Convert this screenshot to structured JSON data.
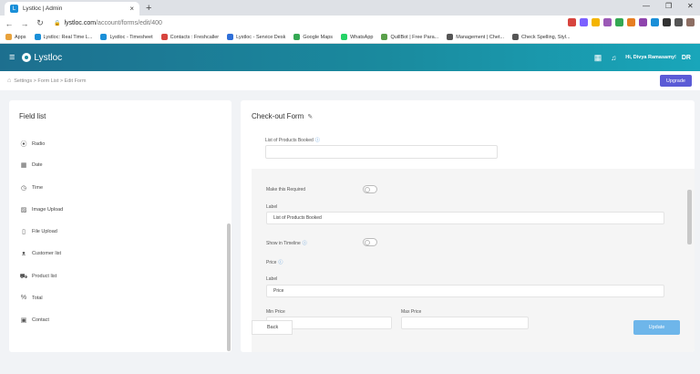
{
  "browser": {
    "tab_title": "Lystloc | Admin",
    "url_host": "lystloc.com",
    "url_path": "/account/forms/edit/400",
    "bookmarks": [
      {
        "label": "Apps",
        "color": "#e8a23c"
      },
      {
        "label": "Lystloc: Real Time L...",
        "color": "#1a8fd8"
      },
      {
        "label": "Lystloc - Timesheet",
        "color": "#1a8fd8"
      },
      {
        "label": "Contacts : Freshcaller",
        "color": "#d7443e"
      },
      {
        "label": "Lystloc - Service Desk",
        "color": "#2f6fd8"
      },
      {
        "label": "Google Maps",
        "color": "#34a853"
      },
      {
        "label": "WhatsApp",
        "color": "#25d366"
      },
      {
        "label": "QuillBot | Free Para...",
        "color": "#5aa04a"
      },
      {
        "label": "Management | Chet...",
        "color": "#555555"
      },
      {
        "label": "Check Spelling, Styl...",
        "color": "#555555"
      }
    ],
    "extensions": [
      "#d7443e",
      "#7b61ff",
      "#f4b400",
      "#9b59b6",
      "#34a853",
      "#e67e22",
      "#8e44ad",
      "#1a8fd8",
      "#333333",
      "#555555",
      "#8d6e63"
    ]
  },
  "app": {
    "brand": "Lystloc",
    "greeting": "Hi, Divya Ramasamy!",
    "initials": "DR",
    "upgrade_label": "Upgrade",
    "breadcrumb": "Settings > Form List > Edit Form"
  },
  "field_list": {
    "title": "Field list",
    "items": [
      {
        "label": "Radio",
        "icon": "radio-icon",
        "glyph": "⦿"
      },
      {
        "label": "Date",
        "icon": "calendar-icon",
        "glyph": "▦"
      },
      {
        "label": "Time",
        "icon": "clock-icon",
        "glyph": "◷"
      },
      {
        "label": "Image Upload",
        "icon": "image-icon",
        "glyph": "▨"
      },
      {
        "label": "File Upload",
        "icon": "file-icon",
        "glyph": "▯"
      },
      {
        "label": "Customer list",
        "icon": "person-icon",
        "glyph": "ᴥ"
      },
      {
        "label": "Product list",
        "icon": "cart-icon",
        "glyph": "⛟"
      },
      {
        "label": "Total",
        "icon": "percent-icon",
        "glyph": "%"
      },
      {
        "label": "Contact",
        "icon": "contact-card-icon",
        "glyph": "▣"
      }
    ]
  },
  "form": {
    "title": "Check-out Form",
    "field_label": "List of Products Booked",
    "make_required_label": "Make this Required",
    "label_caption": "Label",
    "label_value": "List of Products Booked",
    "show_timeline_label": "Show in Timeline",
    "price_label": "Price",
    "price_label_caption": "Label",
    "price_label_value": "Price",
    "min_price_label": "Min Price",
    "max_price_label": "Max Price",
    "back_label": "Back",
    "update_label": "Update"
  }
}
